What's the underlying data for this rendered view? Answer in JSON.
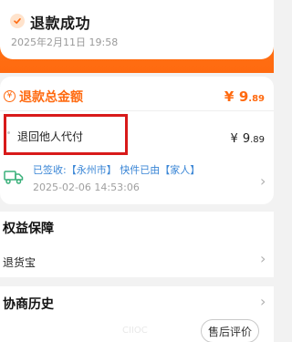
{
  "status": {
    "title": "退款成功",
    "time": "2025年2月11日 19:58"
  },
  "refund": {
    "currency_symbol": "¥",
    "label": "退款总金额",
    "amount_symbol": "¥",
    "amount_int": "9",
    "amount_dec": ".89"
  },
  "payment": {
    "label": "退回他人代付",
    "amount_symbol": "¥",
    "amount_int": "9",
    "amount_dec": ".89"
  },
  "logistics": {
    "text": "已签收:【永州市】 快件已由【家人】",
    "time": "2025-02-06 14:53:06"
  },
  "rights": {
    "title": "权益保障",
    "item": "退货宝"
  },
  "history": {
    "title": "协商历史",
    "faded_text": "CIIOC"
  },
  "actions": {
    "review_label": "售后评价"
  },
  "colors": {
    "accent": "#ff6a10",
    "highlight": "#d81a1a",
    "link": "#3a86d6"
  }
}
